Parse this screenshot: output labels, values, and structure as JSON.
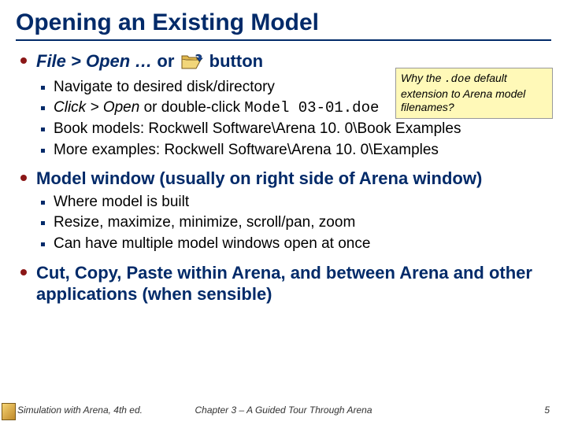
{
  "title": "Opening an Existing Model",
  "callout": {
    "pre": "Why the ",
    "ext": ".doe",
    "post": " default extension to Arena model filenames?"
  },
  "b1": {
    "hl_pre_ital": "File > Open … ",
    "hl_or": "or",
    "hl_button": " button",
    "s1": "Navigate to desired disk/directory",
    "s2_pre": "Click > Open",
    "s2_mid": " or double-click ",
    "s2_mono": "Model 03-01.doe",
    "s3": "Book models: Rockwell Software\\Arena 10. 0\\Book Examples",
    "s4": "More examples: Rockwell Software\\Arena 10. 0\\Examples"
  },
  "b2": {
    "hl": "Model window (usually on right side of Arena window)",
    "s1": "Where model is built",
    "s2": "Resize, maximize, minimize, scroll/pan, zoom",
    "s3": "Can have multiple model windows open at once"
  },
  "b3": {
    "hl": "Cut, Copy, Paste within Arena, and between Arena and other applications (when sensible)"
  },
  "footer": {
    "book": "Simulation with Arena, 4th ed.",
    "chap": "Chapter 3 – A Guided Tour Through Arena",
    "page": "5"
  }
}
